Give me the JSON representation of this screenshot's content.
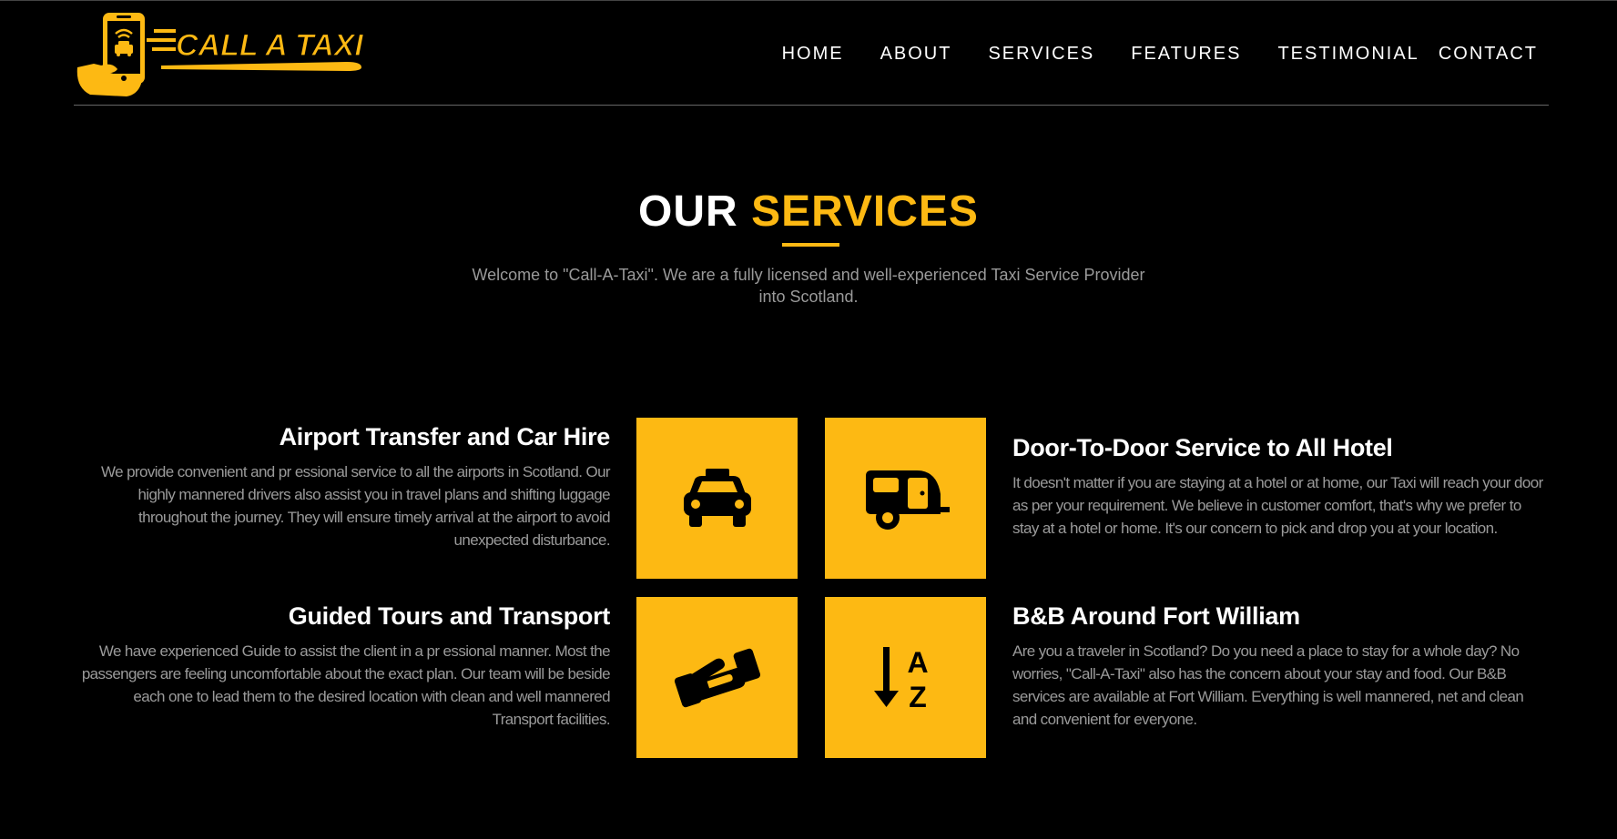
{
  "brand": {
    "logo_text": "CALL A TAXI",
    "accent_color": "#FDB913",
    "background_color": "#000000"
  },
  "nav": {
    "items": [
      {
        "label": "HOME"
      },
      {
        "label": "ABOUT"
      },
      {
        "label": "SERVICES"
      },
      {
        "label": "FEATURES"
      },
      {
        "label": "TESTIMONIAL"
      },
      {
        "label": "CONTACT"
      }
    ]
  },
  "section": {
    "title_part1": "OUR",
    "title_part2": "SERVICES",
    "intro": "Welcome to \"Call-A-Taxi\". We are a fully licensed and well-experienced Taxi Service Provider into Scotland."
  },
  "services": [
    {
      "title": "Airport Transfer and Car Hire",
      "description": "We provide convenient and pr essional service to all the airports in Scotland. Our highly mannered drivers also assist you in travel plans and shifting luggage throughout the journey. They will ensure timely arrival at the airport to avoid unexpected disturbance.",
      "icon": "taxi-icon"
    },
    {
      "title": "Door-To-Door Service to All Hotel",
      "description": "It doesn't matter if you are staying at a hotel or at home, our Taxi will reach your door as per your requirement. We believe in customer comfort, that's why we prefer to stay at a hotel or home. It's our concern to pick and drop you at your location.",
      "icon": "caravan-icon"
    },
    {
      "title": "Guided Tours and Transport",
      "description": "We have experienced Guide to assist the client in a pr essional manner. Most the passengers are feeling uncomfortable about the exact plan. Our team will be beside each one to lead them to the desired location with clean and well mannered Transport facilities.",
      "icon": "handshake-icon"
    },
    {
      "title": "B&B Around Fort William",
      "description": "Are you a traveler in Scotland? Do you need a place to stay for a whole day? No worries, \"Call-A-Taxi\" also has the concern about your stay and food. Our B&B services are available at Fort William. Everything is well mannered, net and clean and convenient for everyone.",
      "icon": "sort-az-icon",
      "icon_letters": [
        "A",
        "Z"
      ]
    }
  ]
}
